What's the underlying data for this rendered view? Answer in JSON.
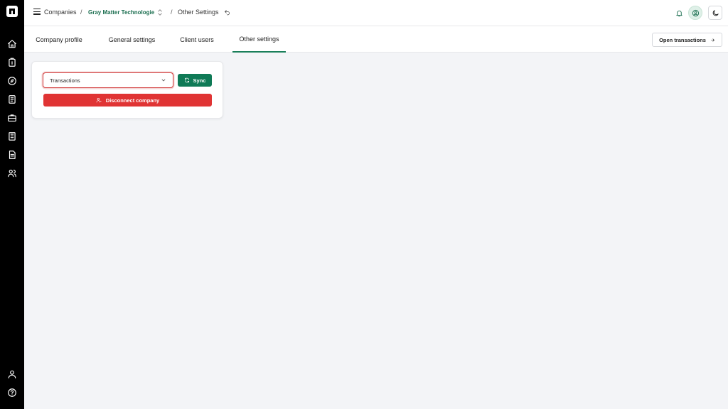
{
  "colors": {
    "sidebar_bg": "#000000",
    "accent_green": "#0f7a56",
    "danger_red": "#e03434",
    "page_bg": "#f3f4f7"
  },
  "sidebar": {
    "logo_icon": "brand-logo-icon",
    "items": [
      {
        "icon": "home-icon"
      },
      {
        "icon": "clipboard-icon"
      },
      {
        "icon": "compass-icon"
      },
      {
        "icon": "file-list-icon"
      },
      {
        "icon": "briefcase-icon"
      },
      {
        "icon": "document-icon"
      },
      {
        "icon": "notes-icon"
      },
      {
        "icon": "users-icon"
      }
    ],
    "bottom_items": [
      {
        "icon": "user-icon"
      },
      {
        "icon": "help-icon"
      }
    ]
  },
  "header": {
    "breadcrumb": {
      "root": "Companies",
      "separator": "/",
      "company": "Gray Matter Technologie",
      "current": "Other Settings"
    }
  },
  "tabs": [
    {
      "label": "Company profile",
      "active": false
    },
    {
      "label": "General settings",
      "active": false
    },
    {
      "label": "Client users",
      "active": false
    },
    {
      "label": "Other settings",
      "active": true
    }
  ],
  "toolbar": {
    "open_transactions_label": "Open transactions"
  },
  "card": {
    "select_value": "Transactions",
    "sync_label": "Sync",
    "disconnect_label": "Disconnect company"
  }
}
